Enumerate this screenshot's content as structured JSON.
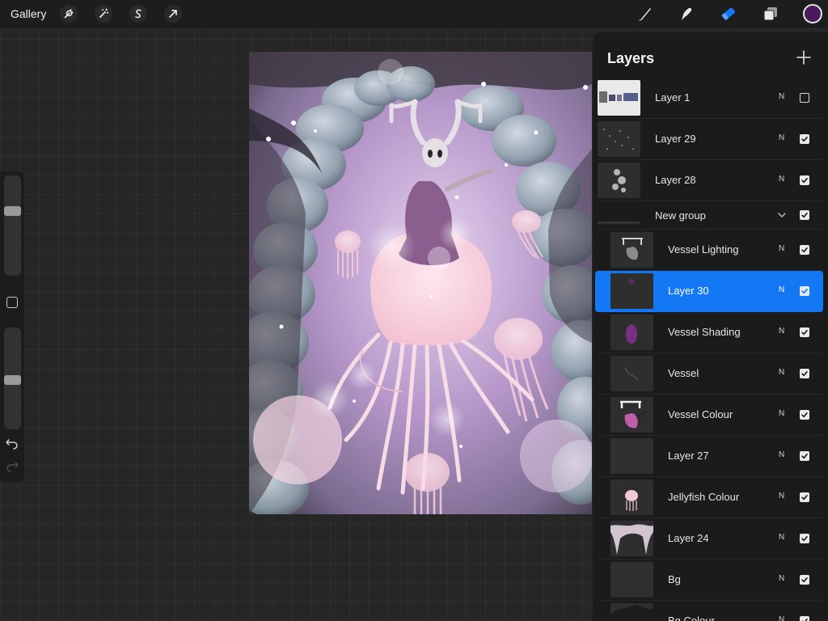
{
  "topbar": {
    "gallery_label": "Gallery",
    "left_tools": [
      "wrench-icon",
      "magic-wand-icon",
      "selection-icon",
      "transform-arrow-icon"
    ],
    "right_tools": [
      "brush-icon",
      "smudge-icon",
      "eraser-icon",
      "layers-icon"
    ],
    "active_tool": "eraser-icon",
    "current_color": "#4a1a5e",
    "accent_color": "#1478f5"
  },
  "sidebar": {
    "brush_size_level": 0.12,
    "opacity_level": 0.52
  },
  "layers_panel": {
    "title": "Layers",
    "layers": [
      {
        "name": "Layer 1",
        "blend": "N",
        "visible": false,
        "selected": false,
        "grouped": false
      },
      {
        "name": "Layer 29",
        "blend": "N",
        "visible": true,
        "selected": false,
        "grouped": false
      },
      {
        "name": "Layer 28",
        "blend": "N",
        "visible": true,
        "selected": false,
        "grouped": false
      },
      {
        "name": "New group",
        "blend": "",
        "visible": true,
        "selected": false,
        "grouped": false,
        "is_group": true
      },
      {
        "name": "Vessel Lighting",
        "blend": "N",
        "visible": true,
        "selected": false,
        "grouped": true
      },
      {
        "name": "Layer 30",
        "blend": "N",
        "visible": true,
        "selected": true,
        "grouped": true
      },
      {
        "name": "Vessel Shading",
        "blend": "N",
        "visible": true,
        "selected": false,
        "grouped": true
      },
      {
        "name": "Vessel",
        "blend": "N",
        "visible": true,
        "selected": false,
        "grouped": true
      },
      {
        "name": "Vessel Colour",
        "blend": "N",
        "visible": true,
        "selected": false,
        "grouped": true
      },
      {
        "name": "Layer 27",
        "blend": "N",
        "visible": true,
        "selected": false,
        "grouped": true
      },
      {
        "name": "Jellyfish Colour",
        "blend": "N",
        "visible": true,
        "selected": false,
        "grouped": true
      },
      {
        "name": "Layer 24",
        "blend": "N",
        "visible": true,
        "selected": false,
        "grouped": true
      },
      {
        "name": "Bg",
        "blend": "N",
        "visible": true,
        "selected": false,
        "grouped": true
      },
      {
        "name": "Bg Colour",
        "blend": "N",
        "visible": true,
        "selected": false,
        "grouped": true
      }
    ]
  }
}
